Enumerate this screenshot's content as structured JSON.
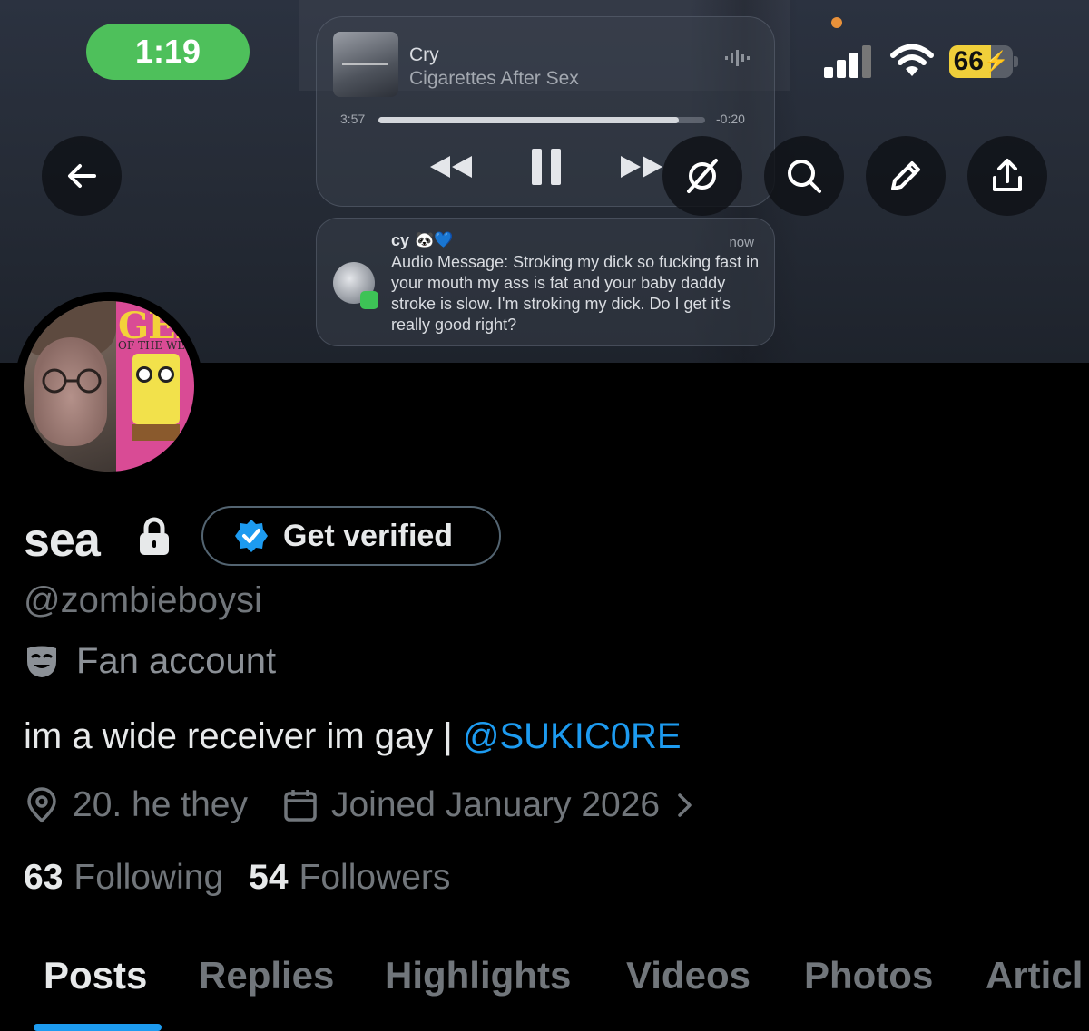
{
  "status_bar": {
    "time": "1:19",
    "battery_level": "66",
    "colors": {
      "time_pill": "#4ec05b",
      "battery": "#f0cf3a",
      "privacy_dot": "#e8913a"
    }
  },
  "now_playing": {
    "title": "Cry",
    "artist": "Cigarettes After Sex",
    "elapsed": "3:57",
    "remaining": "-0:20",
    "progress_fraction": 0.92,
    "icons": [
      "rewind-icon",
      "pause-icon",
      "fast-forward-icon"
    ]
  },
  "notification": {
    "sender": "cy",
    "emoji": "🐼💙",
    "time": "now",
    "message": "Audio Message: Stroking my dick so fucking fast in your mouth my ass is fat and your baby daddy stroke is slow. I'm stroking my dick. Do I get it's really good right?"
  },
  "header_buttons": [
    "back-icon",
    "grok-icon",
    "search-icon",
    "edit-icon",
    "share-icon"
  ],
  "avatar_art": {
    "text_top": "GEE",
    "text_sub": "OF THE WEE"
  },
  "profile": {
    "name": "sea",
    "get_verified_label": "Get verified",
    "handle": "@zombieboysi",
    "category": "Fan account",
    "bio_text": "im a wide receiver im gay | ",
    "bio_mention": "@SUKIC0RE",
    "location": "20. he they",
    "joined": "Joined January 2026",
    "following_count": "63",
    "following_label": "Following",
    "followers_count": "54",
    "followers_label": "Followers"
  },
  "tabs": [
    {
      "label": "Posts",
      "active": true
    },
    {
      "label": "Replies",
      "active": false
    },
    {
      "label": "Highlights",
      "active": false
    },
    {
      "label": "Videos",
      "active": false
    },
    {
      "label": "Photos",
      "active": false
    },
    {
      "label": "Articl",
      "active": false
    }
  ],
  "colors": {
    "accent": "#1d9bf0",
    "background": "#000000",
    "muted_text": "#71767b"
  }
}
